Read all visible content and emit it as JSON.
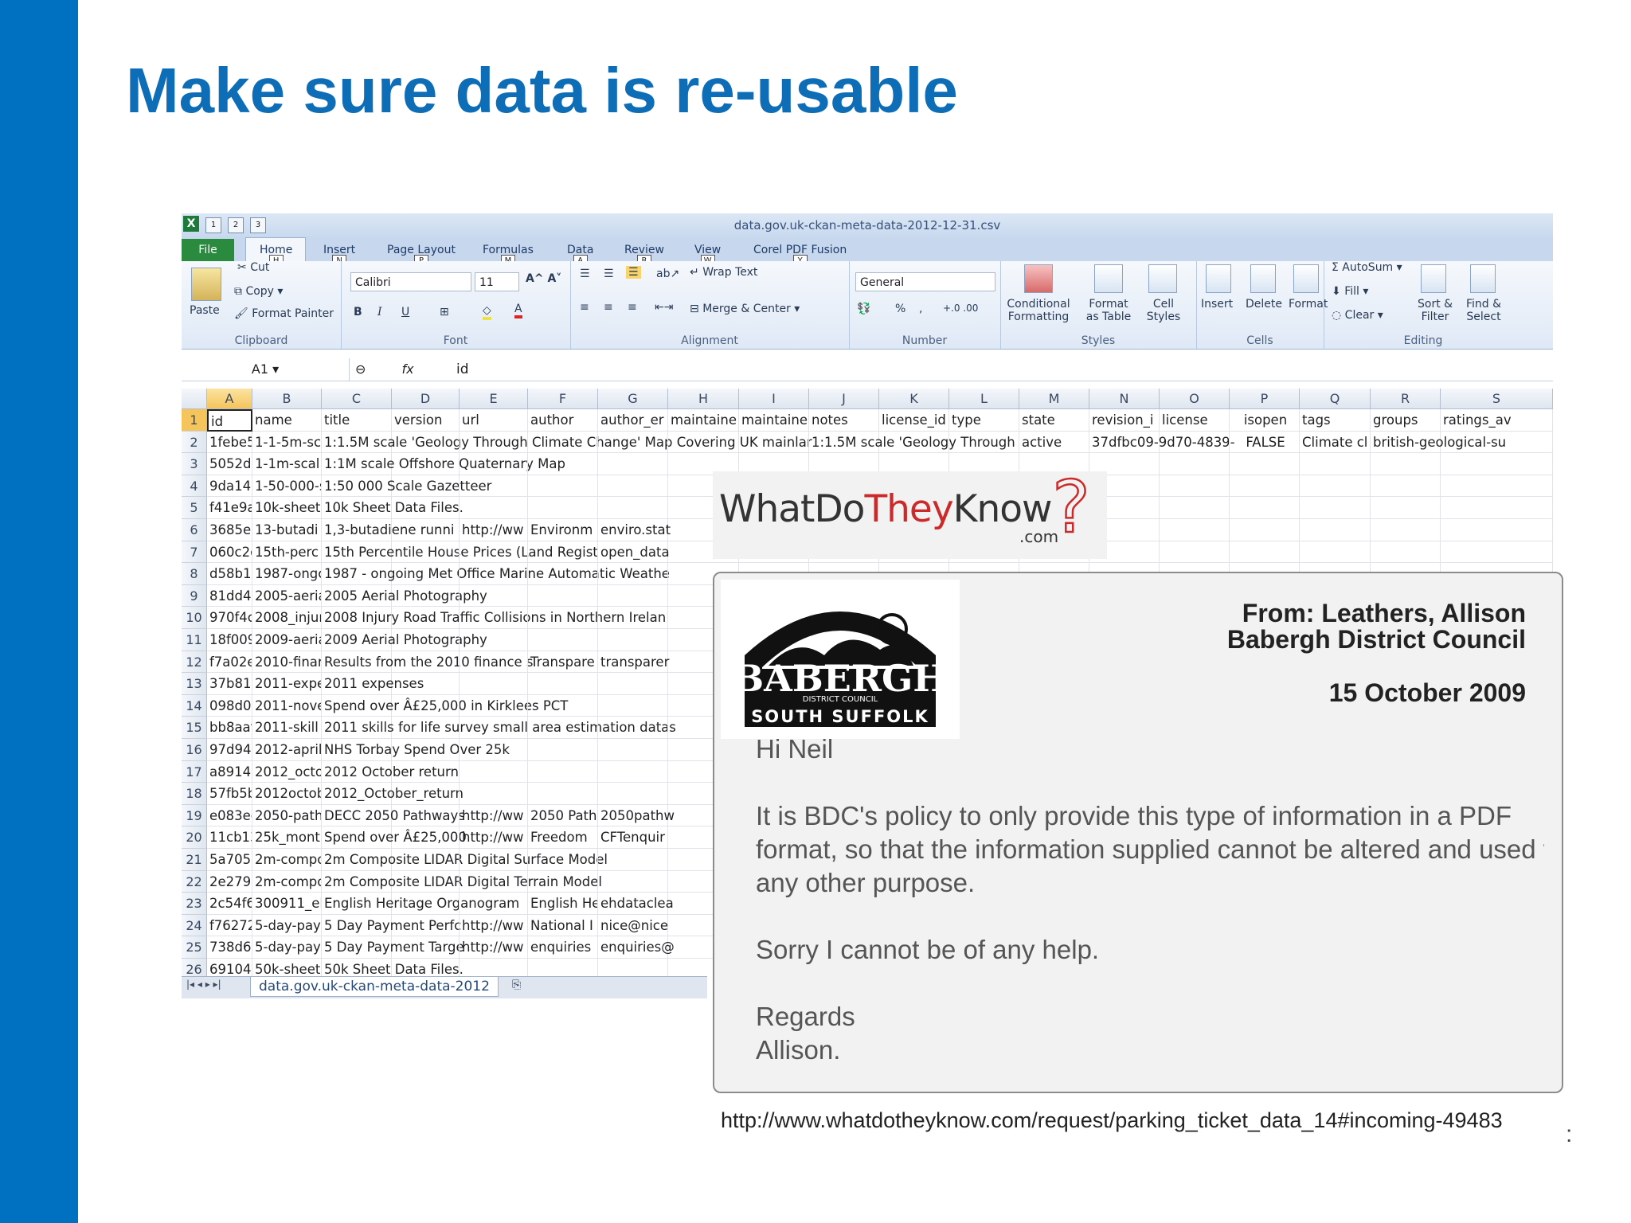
{
  "slide": {
    "title": "Make sure data is re-usable",
    "page_number": ":"
  },
  "excel": {
    "window_title": "data.gov.uk-ckan-meta-data-2012-12-31.csv",
    "tabs": [
      {
        "label": "File",
        "key": "F"
      },
      {
        "label": "Home",
        "key": "H"
      },
      {
        "label": "Insert",
        "key": "N"
      },
      {
        "label": "Page Layout",
        "key": "P"
      },
      {
        "label": "Formulas",
        "key": "M"
      },
      {
        "label": "Data",
        "key": "A"
      },
      {
        "label": "Review",
        "key": "R"
      },
      {
        "label": "View",
        "key": "W"
      },
      {
        "label": "Corel PDF Fusion",
        "key": "Y"
      }
    ],
    "ribbon": {
      "clipboard": {
        "paste": "Paste",
        "cut": "Cut",
        "copy": "Copy",
        "format_painter": "Format Painter",
        "label": "Clipboard"
      },
      "font": {
        "name": "Calibri",
        "size": "11",
        "label": "Font"
      },
      "alignment": {
        "wrap_text": "Wrap Text",
        "merge_center": "Merge & Center",
        "label": "Alignment"
      },
      "number": {
        "format": "General",
        "label": "Number"
      },
      "styles": {
        "conditional": "Conditional",
        "conditional2": "Formatting",
        "format_table": "Format",
        "format_table2": "as Table",
        "cell_styles": "Cell",
        "cell_styles2": "Styles",
        "label": "Styles"
      },
      "cells": {
        "insert": "Insert",
        "delete": "Delete",
        "format": "Format",
        "label": "Cells"
      },
      "editing": {
        "autosum": "AutoSum",
        "fill": "Fill",
        "clear": "Clear",
        "sort": "Sort &",
        "sort2": "Filter",
        "find": "Find &",
        "find2": "Select",
        "label": "Editing"
      }
    },
    "formula_bar": {
      "name_box": "A1",
      "fx": "fx",
      "content": "id"
    },
    "column_headers": [
      "A",
      "B",
      "C",
      "D",
      "E",
      "F",
      "G",
      "H",
      "I",
      "J",
      "K",
      "L",
      "M",
      "N",
      "O",
      "P",
      "Q",
      "R",
      "S"
    ],
    "rows": [
      {
        "n": "1",
        "a": "id",
        "b": "name",
        "c": "title",
        "d": "version",
        "e": "url",
        "f": "author",
        "g": "author_er",
        "h": "maintaine",
        "i": "maintaine",
        "j": "notes",
        "k": "license_id",
        "l": "type",
        "m": "state",
        "n2": "revision_i",
        "o": "license",
        "p": "isopen",
        "q": "tags",
        "r": "groups",
        "s": "ratings_av"
      },
      {
        "n": "2",
        "a": "1febe57b-",
        "b": "1-1-5m-sc",
        "c": "1:1.5M scale 'Geology Through Climate Change' Map Covering UK mainlar",
        "j": "1:1.5M scale 'Geology Through",
        "m": "active",
        "n2": "37dfbc09-9d70-4839-",
        "p": "FALSE",
        "q": "Climate cl",
        "r": "british-geological-su"
      },
      {
        "n": "3",
        "a": "5052d113-",
        "b": "1-1m-scal",
        "c": "1:1M scale Offshore Quaternary Map"
      },
      {
        "n": "4",
        "a": "9da14949-",
        "b": "1-50-000-s",
        "c": "1:50 000 Scale Gazetteer"
      },
      {
        "n": "5",
        "a": "f41e9a4a-",
        "b": "10k-sheet",
        "c": "10k Sheet Data Files."
      },
      {
        "n": "6",
        "a": "3685e98f-",
        "b": "13-butadi",
        "c": "1,3-butadiene runni",
        "e": "http://ww",
        "f": "Environm",
        "g": "enviro.stat"
      },
      {
        "n": "7",
        "a": "060c2c28-",
        "b": "15th-perc",
        "c": "15th Percentile House Prices (Land Regist",
        "g": "open_data"
      },
      {
        "n": "8",
        "a": "d58b1bc0-",
        "b": "1987-ongc",
        "c": "1987 - ongoing Met Office Marine Automatic Weathe"
      },
      {
        "n": "9",
        "a": "81dd47ea-",
        "b": "2005-aeria",
        "c": "2005 Aerial Photography"
      },
      {
        "n": "10",
        "a": "970f4cfc-c",
        "b": "2008_injur",
        "c": "2008 Injury Road Traffic Collisions in Northern Irelan"
      },
      {
        "n": "11",
        "a": "18f0094d-",
        "b": "2009-aeria",
        "c": "2009 Aerial Photography"
      },
      {
        "n": "12",
        "a": "f7a02eef-",
        "b": "2010-finar",
        "c": "Results from the 2010 finance s",
        "f": "Transpare",
        "g": "transparer"
      },
      {
        "n": "13",
        "a": "37b81331-",
        "b": "2011-expe",
        "c": "2011 expenses"
      },
      {
        "n": "14",
        "a": "098d01b7-",
        "b": "2011-nove",
        "c": "Spend over Â£25,000 in Kirklees PCT"
      },
      {
        "n": "15",
        "a": "bb8aafb1-",
        "b": "2011-skill",
        "c": "2011 skills for life survey small area estimation datas"
      },
      {
        "n": "16",
        "a": "97d9444d-",
        "b": "2012-april",
        "c": "NHS Torbay Spend Over 25k"
      },
      {
        "n": "17",
        "a": "a891499e-",
        "b": "2012_octo",
        "c": "2012 October return"
      },
      {
        "n": "18",
        "a": "57fb5b1b-",
        "b": "2012octob",
        "c": "2012_October_return"
      },
      {
        "n": "19",
        "a": "e083ee84-",
        "b": "2050-path",
        "c": "DECC 2050 Pathways",
        "e": "http://ww",
        "f": "2050 Path",
        "g": "2050pathw"
      },
      {
        "n": "20",
        "a": "11cb1364-",
        "b": "25k_mont",
        "c": "Spend over Â£25,000",
        "e": "http://ww",
        "f": "Freedom",
        "g": "CFTenquir"
      },
      {
        "n": "21",
        "a": "5a705e99-",
        "b": "2m-compo",
        "c": "2m Composite LIDAR Digital Surface Model"
      },
      {
        "n": "22",
        "a": "2e279200-",
        "b": "2m-compo",
        "c": "2m Composite LIDAR Digital Terrain Model"
      },
      {
        "n": "23",
        "a": "2c54f62f-0",
        "b": "300911_el",
        "c": "English Heritage Organogram",
        "f": "English He",
        "g": "ehdataclea"
      },
      {
        "n": "24",
        "a": "f76272ce-",
        "b": "5-day-pay",
        "c": "5 Day Payment Perfc",
        "e": "http://ww",
        "f": "National I",
        "g": "nice@nice"
      },
      {
        "n": "25",
        "a": "738d6ca2-",
        "b": "5-day-pay",
        "c": "5 Day Payment Targe",
        "e": "http://ww",
        "f": "enquiries",
        "g": "enquiries@"
      },
      {
        "n": "26",
        "a": "69104bea-",
        "b": "50k-sheet",
        "c": "50k Sheet Data Files."
      }
    ],
    "sheet_tab": "data.gov.uk-ckan-meta-data-2012"
  },
  "wdtk": {
    "what": "WhatDo",
    "they": "They",
    "know": "Know",
    "qmark": "?",
    "com": ".com"
  },
  "letter": {
    "from_line1": "From: Leathers, Allison",
    "from_line2": "Babergh District Council",
    "date": "15 October 2009",
    "greeting": "Hi Neil",
    "para1_l1": "It is BDC's policy to only provide this type of information in a PDF",
    "para1_l2": "format, so that the information supplied cannot be altered and used for",
    "para1_l3": "any other purpose.",
    "para2": "Sorry I cannot be of any help.",
    "regards": "Regards",
    "signoff": "Allison.",
    "seal_name": "BABERGH",
    "seal_sub": "DISTRICT COUNCIL",
    "seal_region": "SOUTH SUFFOLK"
  },
  "source_url": "http://www.whatdotheyknow.com/request/parking_ticket_data_14#incoming-49483"
}
